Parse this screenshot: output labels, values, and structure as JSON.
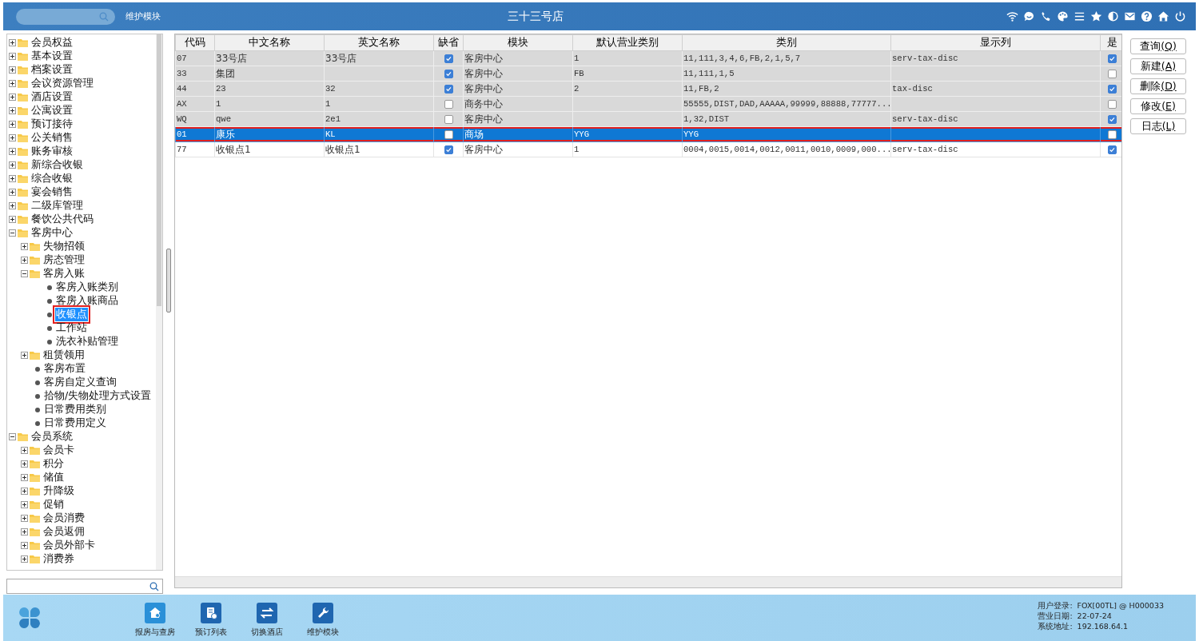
{
  "top_bar": {
    "module_label": "维护模块",
    "title": "三十三号店"
  },
  "tree": [
    {
      "label": "会员权益",
      "expanded": false,
      "selected": false,
      "highlighted": false
    },
    {
      "label": "基本设置",
      "expanded": false,
      "selected": false,
      "highlighted": false
    },
    {
      "label": "档案设置",
      "expanded": false,
      "selected": false,
      "highlighted": false
    },
    {
      "label": "会议资源管理",
      "expanded": false,
      "selected": false,
      "highlighted": false
    },
    {
      "label": "酒店设置",
      "expanded": false,
      "selected": false,
      "highlighted": false
    },
    {
      "label": "公寓设置",
      "expanded": false,
      "selected": false,
      "highlighted": false
    },
    {
      "label": "预订接待",
      "expanded": false,
      "selected": false,
      "highlighted": false
    },
    {
      "label": "公关销售",
      "expanded": false,
      "selected": false,
      "highlighted": false
    },
    {
      "label": "账务审核",
      "expanded": false,
      "selected": false,
      "highlighted": false
    },
    {
      "label": "新综合收银",
      "expanded": false,
      "selected": false,
      "highlighted": false
    },
    {
      "label": "综合收银",
      "expanded": false,
      "selected": false,
      "highlighted": false
    },
    {
      "label": "宴会销售",
      "expanded": false,
      "selected": false,
      "highlighted": false
    },
    {
      "label": "二级库管理",
      "expanded": false,
      "selected": false,
      "highlighted": false
    },
    {
      "label": "餐饮公共代码",
      "expanded": false,
      "selected": false,
      "highlighted": false
    },
    {
      "label": "客房中心",
      "expanded": true,
      "selected": false,
      "highlighted": false,
      "children": [
        {
          "label": "失物招领",
          "expanded": false,
          "selected": false,
          "highlighted": false
        },
        {
          "label": "房态管理",
          "expanded": false,
          "selected": false,
          "highlighted": false
        },
        {
          "label": "客房入账",
          "expanded": true,
          "selected": false,
          "highlighted": false,
          "children": [
            {
              "label": "客房入账类别",
              "kind": "leaf",
              "selected": false,
              "highlighted": false
            },
            {
              "label": "客房入账商品",
              "kind": "leaf",
              "selected": false,
              "highlighted": false
            },
            {
              "label": "收银点",
              "kind": "leaf",
              "selected": true,
              "highlighted": true
            },
            {
              "label": "工作站",
              "kind": "leaf",
              "selected": false,
              "highlighted": false
            },
            {
              "label": "洗衣补贴管理",
              "kind": "leaf",
              "selected": false,
              "highlighted": false
            }
          ]
        },
        {
          "label": "租赁领用",
          "expanded": false,
          "selected": false,
          "highlighted": false
        },
        {
          "label": "客房布置",
          "kind": "leaf",
          "selected": false,
          "highlighted": false
        },
        {
          "label": "客房自定义查询",
          "kind": "leaf",
          "selected": false,
          "highlighted": false
        },
        {
          "label": "拾物/失物处理方式设置",
          "kind": "leaf",
          "selected": false,
          "highlighted": false
        },
        {
          "label": "日常费用类别",
          "kind": "leaf",
          "selected": false,
          "highlighted": false
        },
        {
          "label": "日常费用定义",
          "kind": "leaf",
          "selected": false,
          "highlighted": false
        }
      ]
    },
    {
      "label": "会员系统",
      "expanded": true,
      "selected": false,
      "highlighted": false,
      "children": [
        {
          "label": "会员卡",
          "expanded": false,
          "selected": false,
          "highlighted": false
        },
        {
          "label": "积分",
          "expanded": false,
          "selected": false,
          "highlighted": false
        },
        {
          "label": "储值",
          "expanded": false,
          "selected": false,
          "highlighted": false
        },
        {
          "label": "升降级",
          "expanded": false,
          "selected": false,
          "highlighted": false
        },
        {
          "label": "促销",
          "expanded": false,
          "selected": false,
          "highlighted": false
        },
        {
          "label": "会员消费",
          "expanded": false,
          "selected": false,
          "highlighted": false
        },
        {
          "label": "会员返佣",
          "expanded": false,
          "selected": false,
          "highlighted": false
        },
        {
          "label": "会员外部卡",
          "expanded": false,
          "selected": false,
          "highlighted": false
        },
        {
          "label": "消费券",
          "expanded": false,
          "selected": false,
          "highlighted": false
        }
      ]
    }
  ],
  "table": {
    "columns": [
      "代码",
      "中文名称",
      "英文名称",
      "缺省",
      "模块",
      "默认营业类别",
      "类别",
      "显示列",
      "是"
    ],
    "rows": [
      {
        "cells": [
          "07",
          "33号店",
          "33号店",
          "",
          "客房中心",
          "1",
          "11,111,3,4,6,FB,2,1,5,7",
          "serv-tax-disc",
          ""
        ],
        "default": true,
        "flag": true,
        "greyed": true,
        "selected": false,
        "highlighted": false
      },
      {
        "cells": [
          "33",
          "集团",
          "",
          "",
          "客房中心",
          "FB",
          "11,111,1,5",
          "",
          ""
        ],
        "default": true,
        "flag": false,
        "greyed": true,
        "selected": false,
        "highlighted": false
      },
      {
        "cells": [
          "44",
          "23",
          "32",
          "",
          "客房中心",
          "2",
          "11,FB,2",
          "tax-disc",
          ""
        ],
        "default": true,
        "flag": true,
        "greyed": true,
        "selected": false,
        "highlighted": false
      },
      {
        "cells": [
          "AX",
          "1",
          "1",
          "",
          "商务中心",
          "",
          "55555,DIST,DAD,AAAAA,99999,88888,77777...",
          "",
          ""
        ],
        "default": false,
        "flag": false,
        "greyed": true,
        "selected": false,
        "highlighted": false
      },
      {
        "cells": [
          "WQ",
          "qwe",
          "2e1",
          "",
          "客房中心",
          "",
          "1,32,DIST",
          "serv-tax-disc",
          ""
        ],
        "default": false,
        "flag": true,
        "greyed": true,
        "selected": false,
        "highlighted": false
      },
      {
        "cells": [
          "01",
          "康乐",
          "KL",
          "",
          "商场",
          "YYG",
          "YYG",
          "",
          ""
        ],
        "default": false,
        "flag": false,
        "greyed": false,
        "selected": true,
        "highlighted": true
      },
      {
        "cells": [
          "77",
          "收银点1",
          "收银点1",
          "",
          "客房中心",
          "1",
          "0004,0015,0014,0012,0011,0010,0009,000...",
          "serv-tax-disc",
          ""
        ],
        "default": true,
        "flag": true,
        "greyed": false,
        "selected": false,
        "highlighted": false
      }
    ]
  },
  "actions": [
    {
      "label": "查询",
      "key": "(Q)"
    },
    {
      "label": "新建",
      "key": "(A)"
    },
    {
      "label": "删除",
      "key": "(D)"
    },
    {
      "label": "修改",
      "key": "(E)"
    },
    {
      "label": "日志",
      "key": "(L)"
    }
  ],
  "dock": [
    {
      "kind": "rooms",
      "label": "报房与查房"
    },
    {
      "kind": "booking",
      "label": "预订列表"
    },
    {
      "kind": "switch",
      "label": "切换酒店"
    },
    {
      "kind": "tools",
      "label": "维护模块"
    }
  ],
  "status": [
    {
      "label": "用户登录:",
      "value": "FOX[00TL] @ H000033"
    },
    {
      "label": "营业日期:",
      "value": "22-07-24"
    },
    {
      "label": "系统地址:",
      "value": "192.168.64.1"
    }
  ]
}
